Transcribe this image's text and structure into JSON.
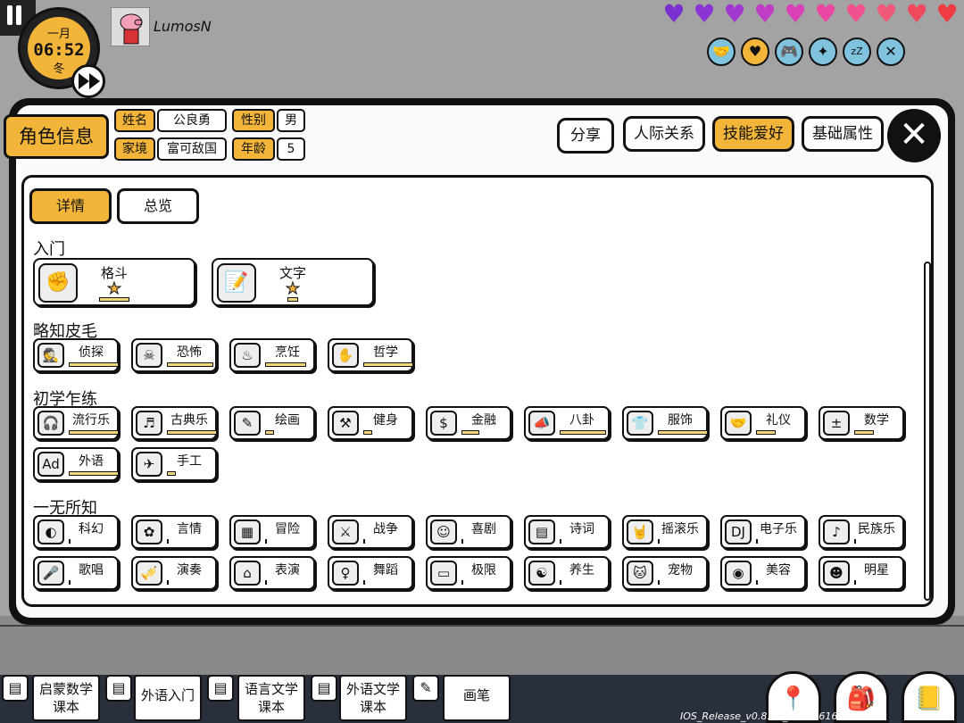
{
  "clock": {
    "month": "一月",
    "time": "06:52",
    "season": "冬"
  },
  "player": {
    "name": "LumosN"
  },
  "hearts": {
    "count": 10,
    "colors": [
      "#7a2fd1",
      "#8b34d6",
      "#a238cf",
      "#c13cc4",
      "#d93fb7",
      "#ea47a4",
      "#f1508f",
      "#f05a78",
      "#ef4a5c",
      "#ee3a42"
    ]
  },
  "status_icons": [
    "handshake-icon",
    "heart-icon",
    "gamepad-icon",
    "sparkle-icon",
    "sleep-icon",
    "food-icon"
  ],
  "header": {
    "role_tab": "角色信息",
    "name_label": "姓名",
    "name_value": "公良勇",
    "gender_label": "性别",
    "gender_value": "男",
    "family_label": "家境",
    "family_value": "富可敌国",
    "age_label": "年龄",
    "age_value": "5",
    "share": "分享",
    "relations": "人际关系",
    "skills": "技能爱好",
    "attributes": "基础属性",
    "close": "✕"
  },
  "subtabs": {
    "detail": "详情",
    "overview": "总览"
  },
  "sections": {
    "entry": {
      "title": "入门",
      "skills": [
        {
          "name": "格斗",
          "icon": "fist-icon",
          "stars": 1
        },
        {
          "name": "文字",
          "icon": "document-icon",
          "stars": 1
        }
      ]
    },
    "basic": {
      "title": "略知皮毛",
      "skills": [
        {
          "name": "侦探",
          "icon": "detective-icon"
        },
        {
          "name": "恐怖",
          "icon": "skull-icon"
        },
        {
          "name": "烹饪",
          "icon": "pot-icon"
        },
        {
          "name": "哲学",
          "icon": "thinker-icon"
        }
      ]
    },
    "beginner": {
      "title": "初学乍练",
      "skills": [
        {
          "name": "流行乐",
          "icon": "headphones-icon"
        },
        {
          "name": "古典乐",
          "icon": "gramophone-icon"
        },
        {
          "name": "绘画",
          "icon": "palette-icon"
        },
        {
          "name": "健身",
          "icon": "dumbbell-icon"
        },
        {
          "name": "金融",
          "icon": "money-icon"
        },
        {
          "name": "八卦",
          "icon": "megaphone-icon"
        },
        {
          "name": "服饰",
          "icon": "shirt-icon"
        },
        {
          "name": "礼仪",
          "icon": "handshake-icon"
        },
        {
          "name": "数学",
          "icon": "calculator-icon"
        },
        {
          "name": "外语",
          "icon": "abc-icon"
        },
        {
          "name": "手工",
          "icon": "paper-plane-icon"
        }
      ]
    },
    "none": {
      "title": "一无所知",
      "skills": [
        {
          "name": "科幻",
          "icon": "planet-icon"
        },
        {
          "name": "言情",
          "icon": "rose-icon"
        },
        {
          "name": "冒险",
          "icon": "map-icon"
        },
        {
          "name": "战争",
          "icon": "swords-icon"
        },
        {
          "name": "喜剧",
          "icon": "clown-icon"
        },
        {
          "name": "诗词",
          "icon": "scroll-icon"
        },
        {
          "name": "摇滚乐",
          "icon": "rock-hand-icon"
        },
        {
          "name": "电子乐",
          "icon": "dj-icon"
        },
        {
          "name": "民族乐",
          "icon": "guitar-icon"
        },
        {
          "name": "歌唱",
          "icon": "microphone-icon"
        },
        {
          "name": "演奏",
          "icon": "trumpet-icon"
        },
        {
          "name": "表演",
          "icon": "stage-icon"
        },
        {
          "name": "舞蹈",
          "icon": "ballet-icon"
        },
        {
          "name": "极限",
          "icon": "skateboard-icon"
        },
        {
          "name": "养生",
          "icon": "yin-yang-icon"
        },
        {
          "name": "宠物",
          "icon": "cat-icon"
        },
        {
          "name": "美容",
          "icon": "eye-icon"
        },
        {
          "name": "明星",
          "icon": "star-person-icon"
        }
      ]
    }
  },
  "bottom": {
    "books": [
      {
        "label": "启蒙数学课本",
        "line1": "启蒙数学",
        "line2": "课本"
      },
      {
        "label": "外语入门",
        "line1": "外语入门",
        "line2": ""
      },
      {
        "label": "语言文学课本",
        "line1": "语言文学",
        "line2": "课本"
      },
      {
        "label": "外语文学课本",
        "line1": "外语文学",
        "line2": "课本"
      },
      {
        "label": "画笔",
        "line1": "画笔",
        "line2": ""
      }
    ],
    "version": "IOS_Release_v0.8.13_20200616"
  },
  "colors": {
    "accent": "#f2b53a",
    "outline": "#111111",
    "panel_bg": "#fafafa"
  }
}
